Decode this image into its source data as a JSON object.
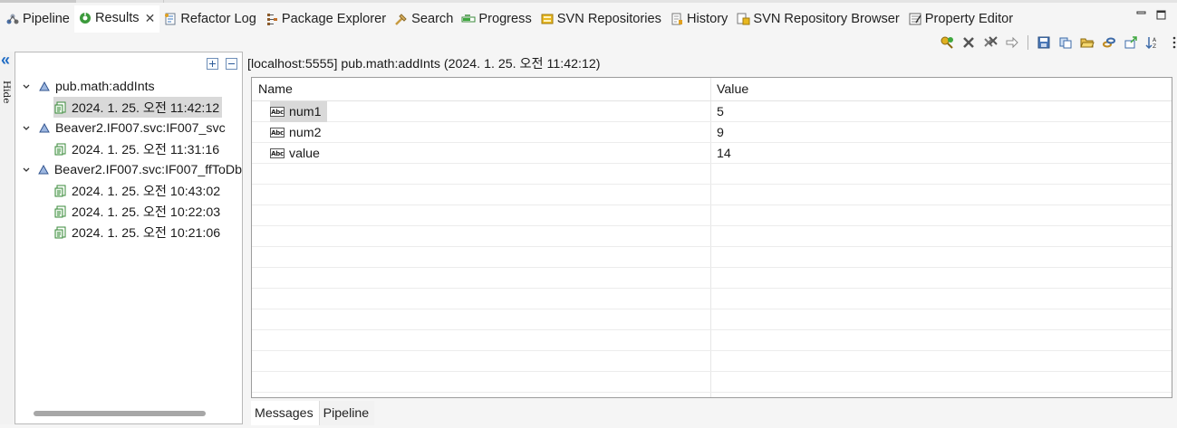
{
  "tabs": [
    {
      "label": "Pipeline",
      "icon": "pipeline-icon",
      "active": false
    },
    {
      "label": "Results",
      "icon": "results-icon",
      "active": true
    },
    {
      "label": "Refactor Log",
      "icon": "refactor-log-icon",
      "active": false
    },
    {
      "label": "Package Explorer",
      "icon": "package-explorer-icon",
      "active": false
    },
    {
      "label": "Search",
      "icon": "search-icon",
      "active": false
    },
    {
      "label": "Progress",
      "icon": "progress-icon",
      "active": false
    },
    {
      "label": "SVN Repositories",
      "icon": "svn-repositories-icon",
      "active": false
    },
    {
      "label": "History",
      "icon": "history-icon",
      "active": false
    },
    {
      "label": "SVN Repository Browser",
      "icon": "svn-repository-browser-icon",
      "active": false
    },
    {
      "label": "Property Editor",
      "icon": "property-editor-icon",
      "active": false
    }
  ],
  "sidebar": {
    "hide_label": "Hide",
    "tree": [
      {
        "label": "pub.math:addInts",
        "expanded": true,
        "children": [
          {
            "label": "2024. 1. 25. 오전 11:42:12",
            "selected": true
          }
        ]
      },
      {
        "label": "Beaver2.IF007.svc:IF007_svc",
        "expanded": true,
        "children": [
          {
            "label": "2024. 1. 25. 오전 11:31:16",
            "selected": false
          }
        ]
      },
      {
        "label": "Beaver2.IF007.svc:IF007_ffToDb",
        "expanded": true,
        "children": [
          {
            "label": "2024. 1. 25. 오전 10:43:02",
            "selected": false
          },
          {
            "label": "2024. 1. 25. 오전 10:22:03",
            "selected": false
          },
          {
            "label": "2024. 1. 25. 오전 10:21:06",
            "selected": false
          }
        ]
      }
    ]
  },
  "main": {
    "title": "[localhost:5555]  pub.math:addInts (2024. 1. 25. 오전 11:42:12)",
    "columns": [
      "Name",
      "Value"
    ],
    "rows": [
      {
        "name": "num1",
        "value": "5",
        "type_icon": "string-type-icon",
        "selected": true
      },
      {
        "name": "num2",
        "value": "9",
        "type_icon": "string-type-icon",
        "selected": false
      },
      {
        "name": "value",
        "value": "14",
        "type_icon": "string-type-icon",
        "selected": false
      }
    ],
    "empty_rows": 11
  },
  "bottom_tabs": [
    {
      "label": "Messages",
      "active": true
    },
    {
      "label": "Pipeline",
      "active": false
    }
  ],
  "colors": {
    "accent": "#1e6bc4",
    "selection": "#d9d9d9",
    "background": "#f5f5f5",
    "panel": "#ffffff"
  }
}
